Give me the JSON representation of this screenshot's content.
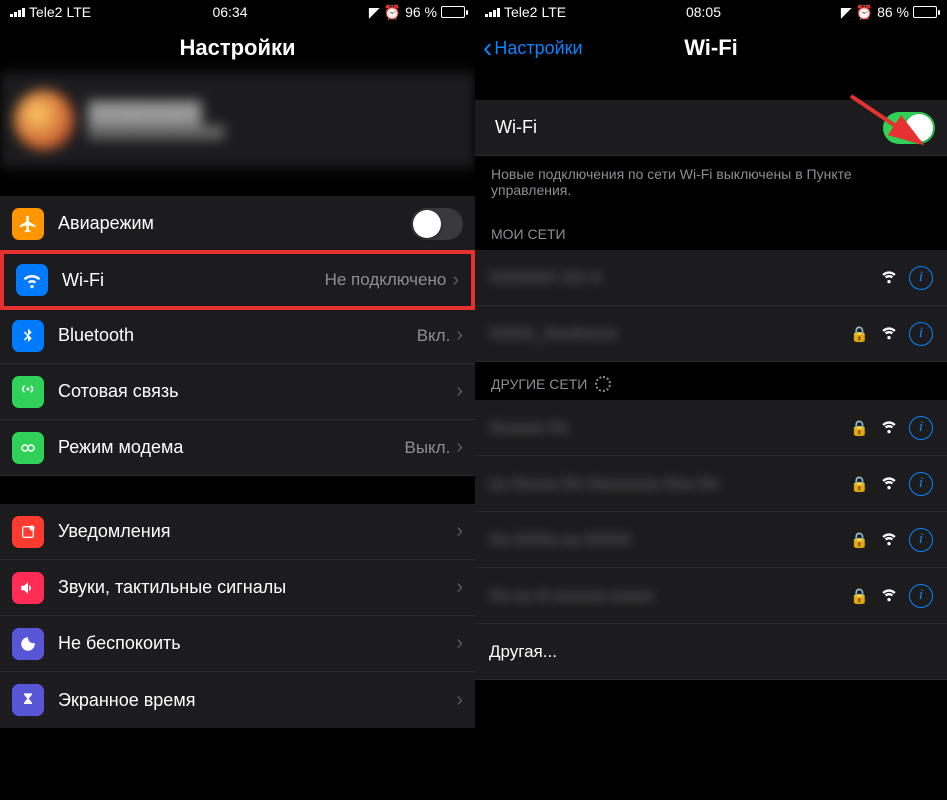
{
  "left": {
    "status": {
      "carrier": "Tele2",
      "network": "LTE",
      "time": "06:34",
      "battery_pct": "96 %"
    },
    "title": "Настройки",
    "rows": {
      "airplane": {
        "label": "Авиарежим",
        "color": "#ff9500"
      },
      "wifi": {
        "label": "Wi-Fi",
        "value": "Не подключено",
        "color": "#007aff"
      },
      "bluetooth": {
        "label": "Bluetooth",
        "value": "Вкл.",
        "color": "#007aff"
      },
      "cellular": {
        "label": "Сотовая связь",
        "color": "#30d158"
      },
      "hotspot": {
        "label": "Режим модема",
        "value": "Выкл.",
        "color": "#30d158"
      },
      "notifications": {
        "label": "Уведомления",
        "color": "#ff3b30"
      },
      "sounds": {
        "label": "Звуки, тактильные сигналы",
        "color": "#ff3b73"
      },
      "dnd": {
        "label": "Не беспокоить",
        "color": "#5856d6"
      },
      "screentime": {
        "label": "Экранное время",
        "color": "#5856d6"
      }
    }
  },
  "right": {
    "status": {
      "carrier": "Tele2",
      "network": "LTE",
      "time": "08:05",
      "battery_pct": "86 %"
    },
    "back_label": "Настройки",
    "title": "Wi-Fi",
    "wifi_toggle_label": "Wi-Fi",
    "help_text": "Новые подключения по сети Wi-Fi выключены в Пункте управления.",
    "my_networks_header": "МОИ СЕТИ",
    "other_networks_header": "ДРУГИЕ СЕТИ",
    "other_label": "Другая..."
  }
}
